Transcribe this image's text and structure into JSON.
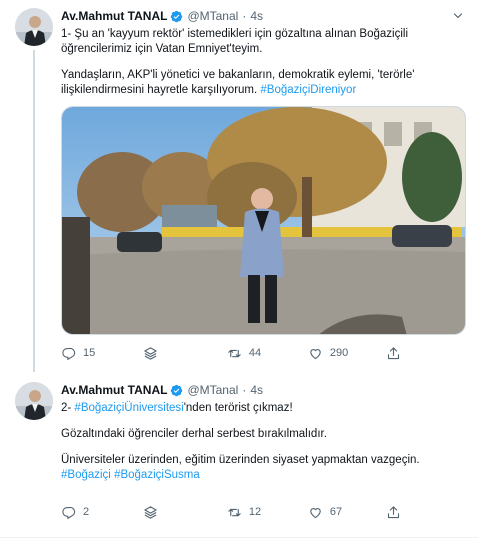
{
  "colors": {
    "accent": "#1d9bf0",
    "secondary_text": "#536471",
    "divider": "#eff3f4"
  },
  "tweets": [
    {
      "author_name": "Av.Mahmut TANAL",
      "handle": "@MTanal",
      "separator": "·",
      "time": "4s",
      "paragraph1": "1- Şu an 'kayyum rektör' istemedikleri için gözaltına alınan Boğaziçili öğrencilerimiz için Vatan Emniyet'teyim.",
      "paragraph2_text": "Yandaşların, AKP'li yönetici ve bakanların, demokratik eylemi, 'terörle' ilişkilendirmesini hayretle karşılıyorum. ",
      "paragraph2_hashtag": "#BoğaziçiDireniyor",
      "has_photo": true,
      "replies": "15",
      "retweets": "44",
      "likes": "290"
    },
    {
      "author_name": "Av.Mahmut TANAL",
      "handle": "@MTanal",
      "separator": "·",
      "time": "4s",
      "line1_prefix": "2- ",
      "line1_hashtag": "#BoğaziçiÜniversitesi",
      "line1_suffix": "'nden terörist çıkmaz!",
      "paragraph2": "Gözaltındaki öğrenciler derhal serbest bırakılmalıdır.",
      "paragraph3": "Üniversiteler üzerinden, eğitim üzerinden siyaset yapmaktan vazgeçin.",
      "hashtag_a": "#Boğaziçi",
      "hashtag_b": "#BoğaziçiSusma",
      "replies": "2",
      "retweets": "12",
      "likes": "67"
    }
  ],
  "icons": [
    "verified-badge-icon",
    "chevron-down-icon",
    "reply-icon",
    "stack-icon",
    "retweet-icon",
    "like-icon",
    "share-icon"
  ]
}
